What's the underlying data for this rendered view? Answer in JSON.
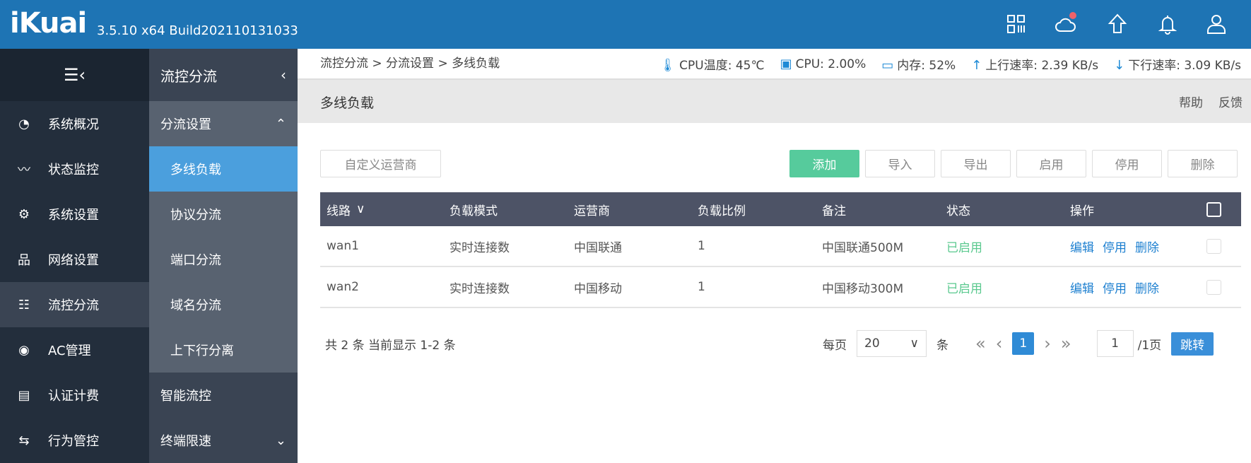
{
  "header": {
    "logo": "iKuai",
    "version": "3.5.10 x64 Build202110131033",
    "icons": [
      "apps-icon",
      "cloud-icon",
      "upgrade-icon",
      "bell-icon",
      "user-icon"
    ]
  },
  "sidebar": {
    "items": [
      {
        "label": "系统概况",
        "icon": "dashboard-icon"
      },
      {
        "label": "状态监控",
        "icon": "monitor-icon"
      },
      {
        "label": "系统设置",
        "icon": "gear-icon"
      },
      {
        "label": "网络设置",
        "icon": "network-icon"
      },
      {
        "label": "流控分流",
        "icon": "sliders-icon",
        "active": true
      },
      {
        "label": "AC管理",
        "icon": "wifi-icon"
      },
      {
        "label": "认证计费",
        "icon": "id-card-icon"
      },
      {
        "label": "行为管控",
        "icon": "swap-icon"
      }
    ]
  },
  "subnav": {
    "title": "流控分流",
    "group": "分流设置",
    "items": [
      "多线负载",
      "协议分流",
      "端口分流",
      "域名分流",
      "上下行分离"
    ],
    "others": [
      "智能流控",
      "终端限速"
    ]
  },
  "breadcrumb": "流控分流 > 分流设置 > 多线负载",
  "stats": {
    "cpu_temp": "CPU温度: 45℃",
    "cpu": "CPU: 2.00%",
    "mem": "内存: 52%",
    "up": "上行速率: 2.39 KB/s",
    "down": "下行速率: 3.09 KB/s"
  },
  "page": {
    "title": "多线负载",
    "help": "帮助",
    "feedback": "反馈"
  },
  "toolbar": {
    "custom": "自定义运营商",
    "add": "添加",
    "import": "导入",
    "export": "导出",
    "enable": "启用",
    "disable": "停用",
    "delete": "删除"
  },
  "table": {
    "columns": [
      "线路",
      "负载模式",
      "运营商",
      "负载比例",
      "备注",
      "状态",
      "操作"
    ],
    "rows": [
      {
        "line": "wan1",
        "mode": "实时连接数",
        "isp": "中国联通",
        "ratio": "1",
        "note": "中国联通500M",
        "status": "已启用",
        "edit": "编辑",
        "disable": "停用",
        "delete": "删除"
      },
      {
        "line": "wan2",
        "mode": "实时连接数",
        "isp": "中国移动",
        "ratio": "1",
        "note": "中国移动300M",
        "status": "已启用",
        "edit": "编辑",
        "disable": "停用",
        "delete": "删除"
      }
    ]
  },
  "pagination": {
    "summary": "共 2 条 当前显示 1-2 条",
    "per_page_label": "每页",
    "per_page": "20",
    "unit": "条",
    "current": "1",
    "page_input": "1",
    "total": "/1页",
    "jump": "跳转"
  },
  "colors": {
    "header": "#1e74b4",
    "add": "#56cb9c",
    "enabled": "#5bc98f",
    "link": "#1e80d0"
  }
}
